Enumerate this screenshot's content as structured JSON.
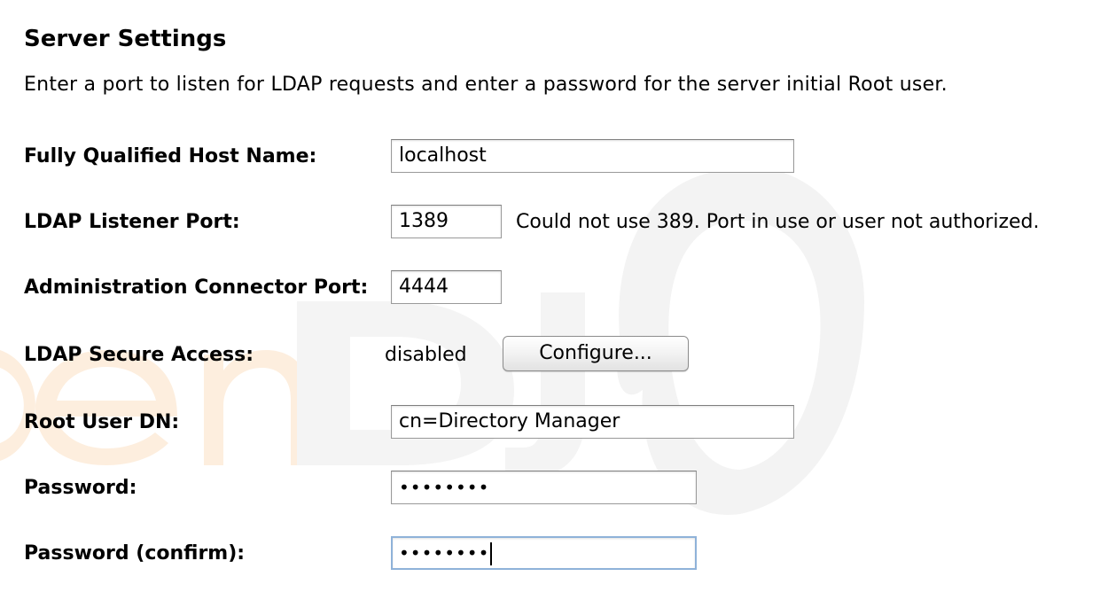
{
  "header": {
    "title": "Server Settings",
    "description": "Enter a port to listen for LDAP requests and enter a password for the server initial Root user."
  },
  "form": {
    "host_name": {
      "label": "Fully Qualified Host Name:",
      "value": "localhost"
    },
    "ldap_port": {
      "label": "LDAP Listener Port:",
      "value": "1389",
      "message": "Could not use 389. Port in use or user not authorized."
    },
    "admin_port": {
      "label": "Administration Connector Port:",
      "value": "4444"
    },
    "secure_access": {
      "label": "LDAP Secure Access:",
      "status": "disabled",
      "button_label": "Configure..."
    },
    "root_dn": {
      "label": "Root User DN:",
      "value": "cn=Directory Manager"
    },
    "password": {
      "label": "Password:",
      "masked_value": "••••••••"
    },
    "password_confirm": {
      "label": "Password (confirm):",
      "masked_value": "••••••••"
    }
  },
  "colors": {
    "focus_border": "#8fb2d9",
    "field_border": "#9a9a9a",
    "watermark_orange": "#fdeede",
    "watermark_gray": "#f3f3f3"
  },
  "icons": {
    "watermark": "opendj-logo-watermark"
  }
}
